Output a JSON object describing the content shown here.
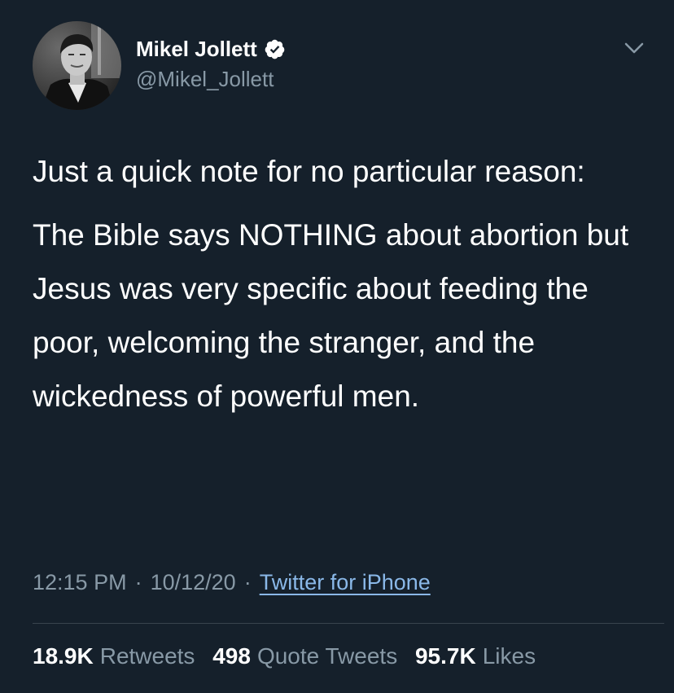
{
  "author": {
    "display_name": "Mikel Jollett",
    "handle": "@Mikel_Jollett",
    "verified": true,
    "verified_icon": "verified-badge-icon",
    "avatar_icon": "avatar-photo"
  },
  "menu": {
    "icon": "chevron-down-icon"
  },
  "tweet": {
    "paragraphs": [
      "Just a quick note for no particular reason:",
      "The Bible says NOTHING about abortion but Jesus was very specific about feeding the poor, welcoming the stranger, and the wickedness of powerful men."
    ],
    "time": "12:15 PM",
    "date": "10/12/20",
    "separator": "·",
    "source": "Twitter for iPhone"
  },
  "stats": {
    "retweets_count": "18.9K",
    "retweets_label": "Retweets",
    "quotes_count": "498",
    "quotes_label": "Quote Tweets",
    "likes_count": "95.7K",
    "likes_label": "Likes"
  },
  "colors": {
    "background": "#15202b",
    "primary_text": "#ffffff",
    "secondary_text": "#8899a6",
    "link": "#8ab8e8",
    "divider": "#38444d"
  }
}
